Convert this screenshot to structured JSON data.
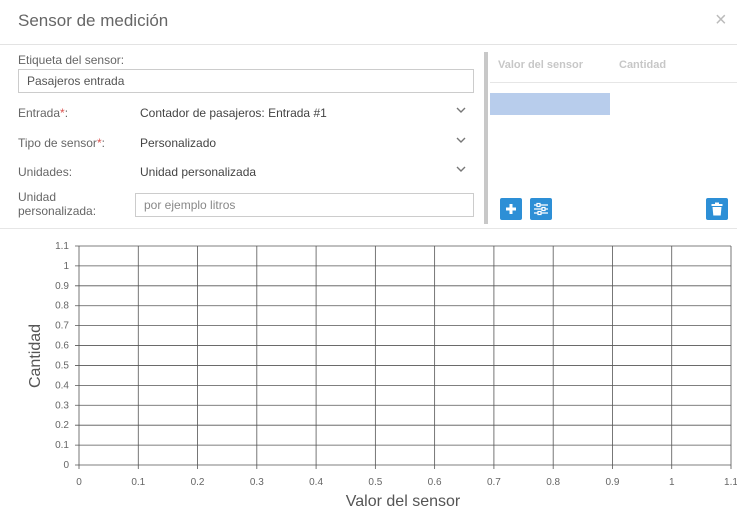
{
  "dialog": {
    "title": "Sensor de medición",
    "close_label": "×"
  },
  "form": {
    "sensor_label": "Etiqueta del sensor:",
    "sensor_value": "Pasajeros entrada",
    "input_label": "Entrada",
    "input_value": "Contador de pasajeros: Entrada #1",
    "type_label": "Tipo de sensor",
    "type_value": "Personalizado",
    "units_label": "Unidades:",
    "units_value": "Unidad personalizada",
    "custom_unit_label_1": "Unidad",
    "custom_unit_label_2": "personalizada:",
    "custom_unit_placeholder": "por ejemplo litros",
    "required_mark": "*",
    "colon": ":"
  },
  "table": {
    "col_sensor": "Valor del sensor",
    "col_quantity": "Cantidad"
  },
  "colors": {
    "accent": "#2d8fd6",
    "selected_row": "#b8cdec",
    "required": "#d9534f"
  },
  "chart_data": {
    "type": "line",
    "xlabel": "Valor del sensor",
    "ylabel": "Cantidad",
    "xlim": [
      0,
      1.1
    ],
    "ylim": [
      0,
      1.1
    ],
    "x_ticks": [
      "0",
      "0.1",
      "0.2",
      "0.3",
      "0.4",
      "0.5",
      "0.6",
      "0.7",
      "0.8",
      "0.9",
      "1",
      "1.1"
    ],
    "y_ticks": [
      "1.1",
      "1",
      "0.9",
      "0.8",
      "0.7",
      "0.6",
      "0.5",
      "0.4",
      "0.3",
      "0.2",
      "0.1",
      "0"
    ],
    "grid": true,
    "series": []
  }
}
